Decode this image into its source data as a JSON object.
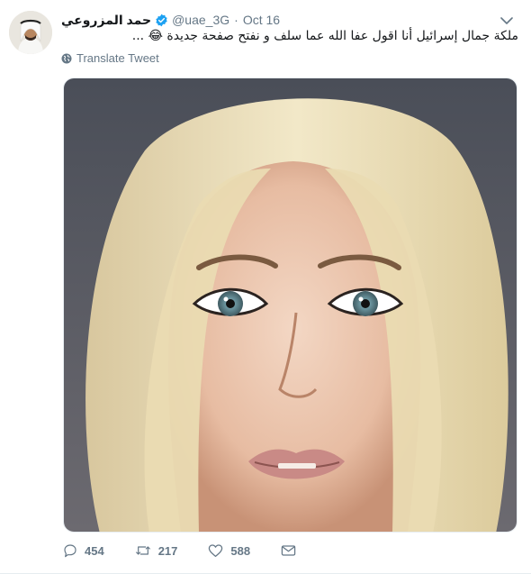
{
  "author": {
    "display_name": "حمد المزروعي",
    "handle": "@uae_3G",
    "time": "Oct 16",
    "verified": true
  },
  "tweet": {
    "text": "ملكة جمال إسرائيل أنا اقول عفا الله عما سلف و نفتح صفحة جديدة 😂 ...",
    "translate_label": "Translate Tweet"
  },
  "actions": {
    "replies": "454",
    "retweets": "217",
    "likes": "588"
  },
  "colors": {
    "verified_blue": "#1da1f2",
    "meta_gray": "#657786",
    "text": "#14171a",
    "divider": "#e6ecf0"
  },
  "icons": [
    "caret-down-icon",
    "globe-icon",
    "reply-icon",
    "retweet-icon",
    "like-icon",
    "direct-message-icon",
    "verified-badge-icon"
  ]
}
